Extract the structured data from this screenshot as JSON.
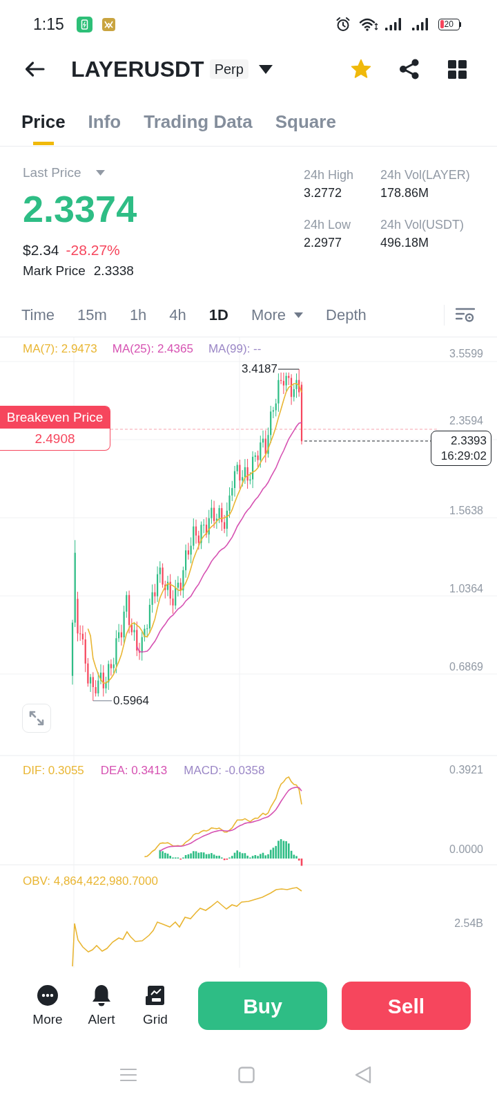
{
  "status_bar": {
    "time": "1:15",
    "battery": "20"
  },
  "header": {
    "symbol": "LAYERUSDT",
    "badge": "Perp",
    "favorite": true
  },
  "tabs": [
    {
      "label": "Price",
      "selected": true
    },
    {
      "label": "Info",
      "selected": false
    },
    {
      "label": "Trading Data",
      "selected": false
    },
    {
      "label": "Square",
      "selected": false
    }
  ],
  "price_panel": {
    "last_price_label": "Last Price",
    "last_price": "2.3374",
    "usd_price": "$2.34",
    "change": "-28.27%",
    "mark_price_label": "Mark Price",
    "mark_price": "2.3338"
  },
  "stats": [
    {
      "label": "24h High",
      "value": "3.2772"
    },
    {
      "label": "24h Vol(LAYER)",
      "value": "178.86M"
    },
    {
      "label": "24h Low",
      "value": "2.2977"
    },
    {
      "label": "24h Vol(USDT)",
      "value": "496.18M"
    }
  ],
  "intervals": [
    {
      "label": "Time",
      "kind": "option",
      "selected": false
    },
    {
      "label": "15m",
      "kind": "option",
      "selected": false
    },
    {
      "label": "1h",
      "kind": "option",
      "selected": false
    },
    {
      "label": "4h",
      "kind": "option",
      "selected": false
    },
    {
      "label": "1D",
      "kind": "option",
      "selected": true
    },
    {
      "label": "More",
      "kind": "dropdown",
      "selected": false
    },
    {
      "label": "Depth",
      "kind": "option",
      "selected": false
    }
  ],
  "chart": {
    "ma_legend": [
      {
        "label": "MA(7): 2.9473",
        "color": "#e9b634"
      },
      {
        "label": "MA(25): 2.4365",
        "color": "#d652b2"
      },
      {
        "label": "MA(99): --",
        "color": "#9b87c6"
      }
    ],
    "price_axis": [
      "3.5599",
      "2.3594",
      "1.5638",
      "1.0364",
      "0.6869"
    ],
    "breakeven": {
      "label": "Breakeven Price",
      "value": "2.4908"
    },
    "current_price": {
      "price": "2.3393",
      "countdown": "16:29:02"
    },
    "high_marker": "3.4187",
    "low_marker": "0.5964"
  },
  "macd": {
    "legend": [
      {
        "label": "DIF: 0.3055",
        "color": "#e9b634"
      },
      {
        "label": "DEA: 0.3413",
        "color": "#d652b2"
      },
      {
        "label": "MACD: -0.0358",
        "color": "#9b87c6"
      }
    ],
    "axis": [
      "0.3921",
      "0.0000"
    ]
  },
  "obv": {
    "legend": "OBV: 4,864,422,980.7000",
    "axis": [
      "2.54B"
    ]
  },
  "actions": [
    {
      "label": "More",
      "kind": "more"
    },
    {
      "label": "Alert",
      "kind": "alert"
    },
    {
      "label": "Grid",
      "kind": "grid"
    }
  ],
  "trade_buttons": [
    {
      "label": "Buy",
      "kind": "buy"
    },
    {
      "label": "Sell",
      "kind": "sell"
    }
  ]
}
